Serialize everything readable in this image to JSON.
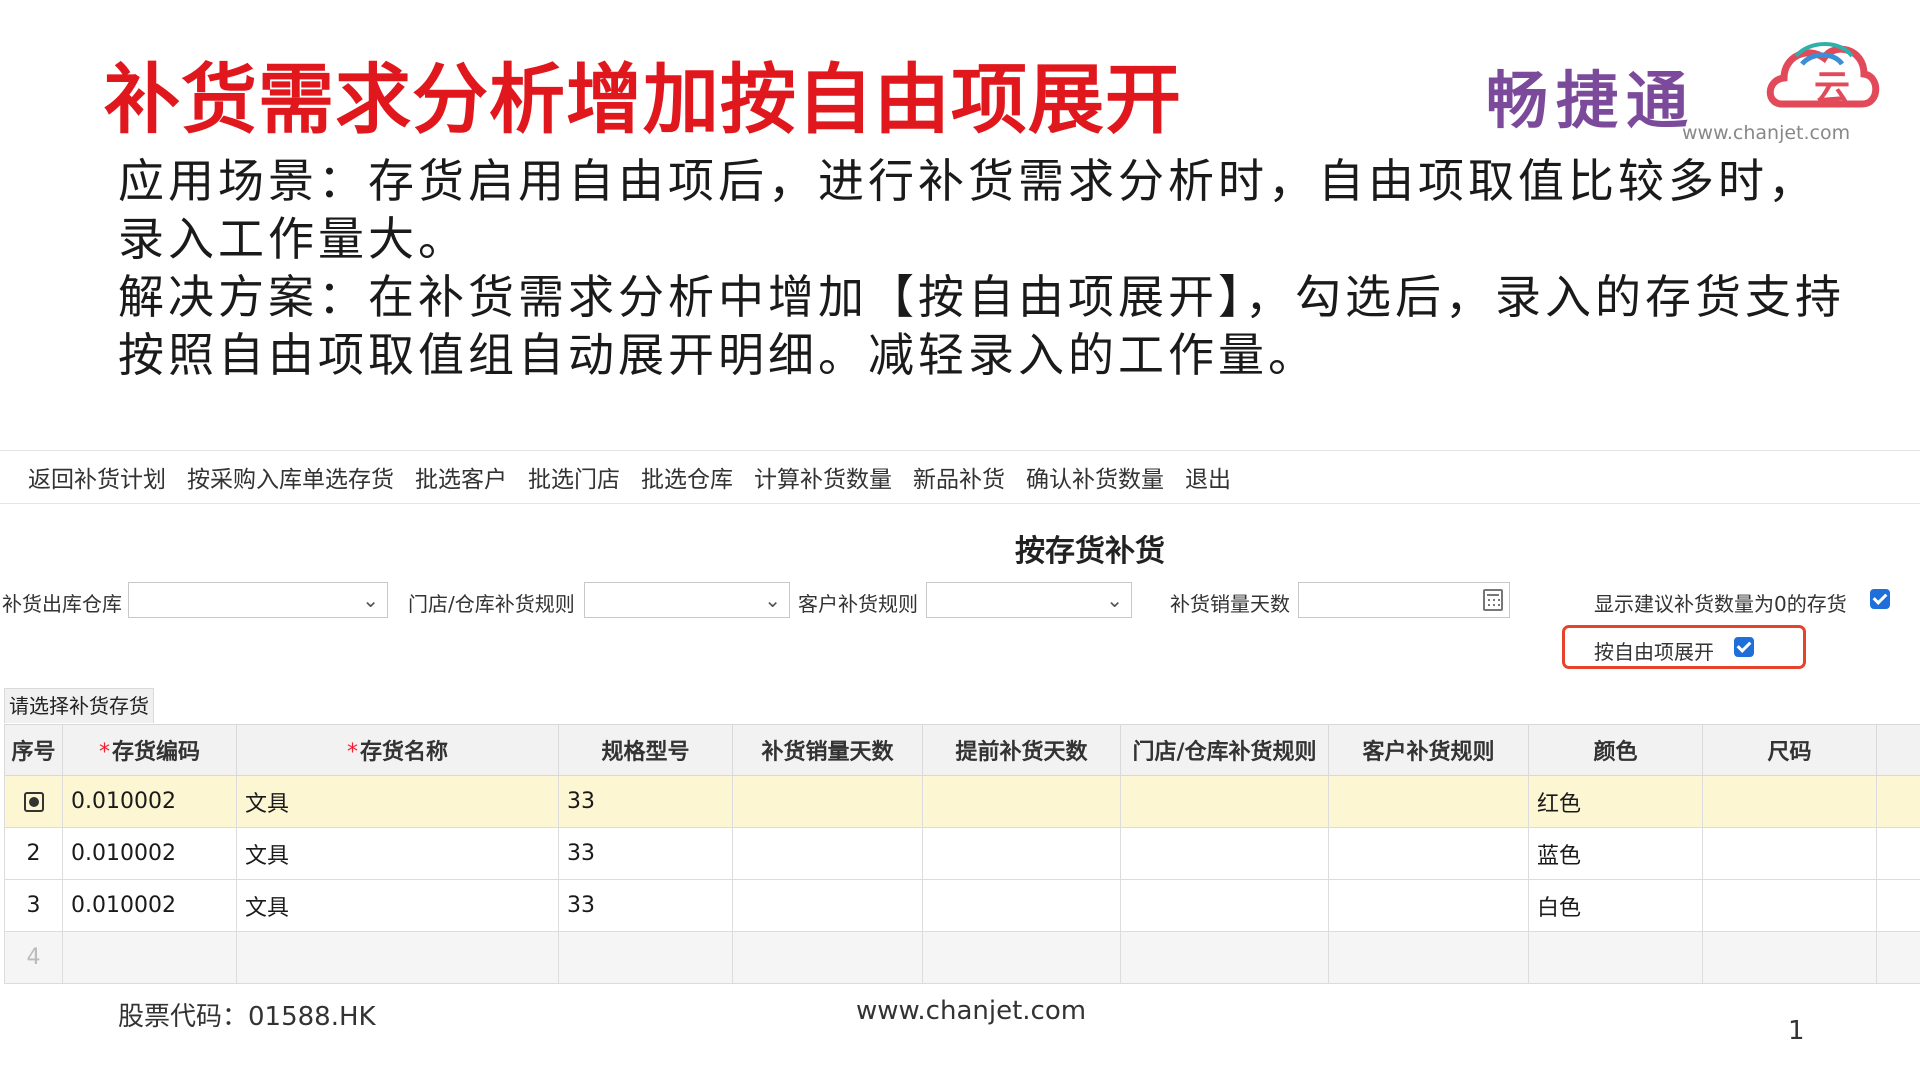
{
  "slide": {
    "title": "补货需求分析增加按自由项展开",
    "brand_name": "畅捷通",
    "brand_url": "www.chanjet.com",
    "desc_line1": "应用场景：存货启用自由项后，进行补货需求分析时，自由项取值比较多时，录入工作量大。",
    "desc_line2": "解决方案：在补货需求分析中增加【按自由项展开】，勾选后，录入的存货支持按照自由项取值组自动展开明细。减轻录入的工作量。",
    "footer_stock": "股票代码：01588.HK",
    "footer_url": "www.chanjet.com",
    "page_number": "1"
  },
  "toolbar": {
    "items": [
      "返回补货计划",
      "按采购入库单选存货",
      "批选客户",
      "批选门店",
      "批选仓库",
      "计算补货数量",
      "新品补货",
      "确认补货数量",
      "退出"
    ]
  },
  "form": {
    "title": "按存货补货",
    "warehouse_label": "补货出库仓库",
    "warehouse_value": "",
    "store_rule_label": "门店/仓库补货规则",
    "store_rule_value": "",
    "customer_rule_label": "客户补货规则",
    "customer_rule_value": "",
    "sales_days_label": "补货销量天数",
    "sales_days_value": "",
    "show_zero_label": "显示建议补货数量为0的存货",
    "show_zero_checked": true,
    "expand_free_label": "按自由项展开",
    "expand_free_checked": true,
    "select_tab": "请选择补货存货"
  },
  "grid": {
    "columns": [
      {
        "label": "序号",
        "required": false
      },
      {
        "label": "存货编码",
        "required": true
      },
      {
        "label": "存货名称",
        "required": true
      },
      {
        "label": "规格型号",
        "required": false
      },
      {
        "label": "补货销量天数",
        "required": false
      },
      {
        "label": "提前补货天数",
        "required": false
      },
      {
        "label": "门店/仓库补货规则",
        "required": false
      },
      {
        "label": "客户补货规则",
        "required": false
      },
      {
        "label": "颜色",
        "required": false
      },
      {
        "label": "尺码",
        "required": false
      }
    ],
    "required_mark": "*",
    "rows": [
      {
        "idx": "",
        "code": "0.010002",
        "name": "文具",
        "spec": "33",
        "color": "红色",
        "size": ""
      },
      {
        "idx": "2",
        "code": "0.010002",
        "name": "文具",
        "spec": "33",
        "color": "蓝色",
        "size": ""
      },
      {
        "idx": "3",
        "code": "0.010002",
        "name": "文具",
        "spec": "33",
        "color": "白色",
        "size": ""
      }
    ],
    "empty_row_idx": "4"
  }
}
